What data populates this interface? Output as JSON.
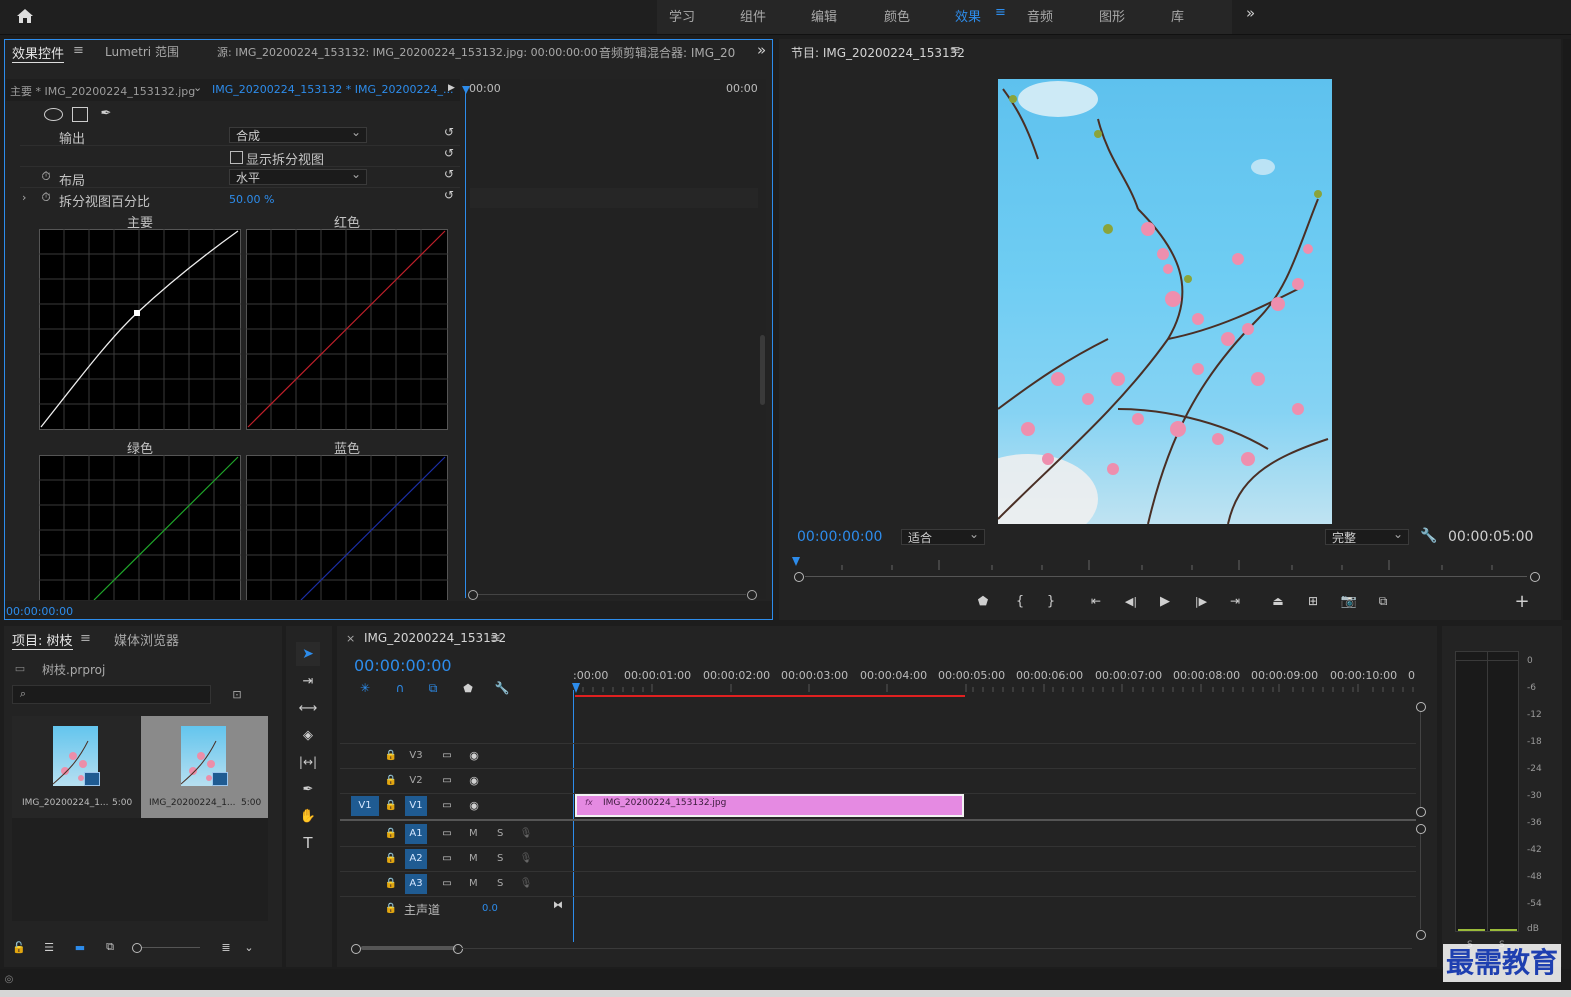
{
  "topbar": {
    "tabs": [
      "学习",
      "组件",
      "编辑",
      "颜色",
      "效果",
      "音频",
      "图形",
      "库"
    ],
    "active_tab": "效果",
    "more": "»"
  },
  "effect_controls": {
    "tabs": [
      "效果控件",
      "Lumetri 范围",
      "源: IMG_20200224_153132: IMG_20200224_153132.jpg: 00:00:00:00",
      "音频剪辑混合器: IMG_20"
    ],
    "clip_master": "主要 * IMG_20200224_153132.jpg",
    "clip_seq": "IMG_20200224_153132 * IMG_20200224_...",
    "time_start": "00:00",
    "time_end": "00:00",
    "output_label": "输出",
    "output_value": "合成",
    "split_view_label": "显示拆分视图",
    "layout_label": "布局",
    "layout_value": "水平",
    "split_percent_label": "拆分视图百分比",
    "split_percent_value": "50.00 %",
    "curve_master": "主要",
    "curve_red": "红色",
    "curve_green": "绿色",
    "curve_blue": "蓝色",
    "footer_time": "00:00:00:00"
  },
  "program": {
    "title": "节目: IMG_20200224_153132",
    "timecode": "00:00:00:00",
    "fit": "适合",
    "quality": "完整",
    "duration": "00:00:05:00"
  },
  "project": {
    "tabs": [
      "项目: 树枝",
      "媒体浏览器"
    ],
    "file": "树枝.prproj",
    "items": [
      {
        "name": "IMG_20200224_1...",
        "dur": "5:00"
      },
      {
        "name": "IMG_20200224_1...",
        "dur": "5:00"
      }
    ]
  },
  "timeline": {
    "title": "IMG_20200224_153132",
    "timecode": "00:00:00:00",
    "ruler": [
      ":00:00",
      "00:00:01:00",
      "00:00:02:00",
      "00:00:03:00",
      "00:00:04:00",
      "00:00:05:00",
      "00:00:06:00",
      "00:00:07:00",
      "00:00:08:00",
      "00:00:09:00",
      "00:00:10:00",
      "0"
    ],
    "video_tracks": [
      "V3",
      "V2",
      "V1"
    ],
    "source_v": "V1",
    "audio_tracks": [
      "A1",
      "A2",
      "A3"
    ],
    "m_label": "M",
    "s_label": "S",
    "master_label": "主声道",
    "master_value": "0.0",
    "clip_name": "IMG_20200224_153132.jpg",
    "clip_fx": "fx"
  },
  "meter": {
    "labels": [
      "0",
      "-6",
      "-12",
      "-18",
      "-24",
      "-30",
      "-36",
      "-42",
      "-48",
      "-54",
      "dB"
    ],
    "solo": [
      "S",
      "S"
    ]
  },
  "watermark": "最需教育",
  "colors": {
    "accent": "#2d8ceb",
    "clip": "#e58ae2",
    "playhead_red": "#e02020"
  }
}
